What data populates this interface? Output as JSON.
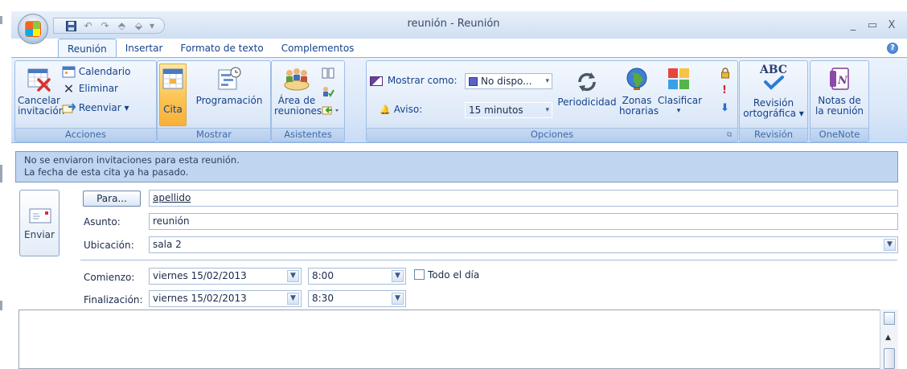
{
  "window": {
    "title": "reunión - Reunión",
    "controls": {
      "minimize": "_",
      "maximize": "▭",
      "close": "X"
    }
  },
  "quick_access": [
    "save-icon",
    "undo-icon",
    "redo-icon",
    "up-icon",
    "down-icon",
    "customize-icon"
  ],
  "tabs": [
    {
      "label": "Reunión",
      "active": true
    },
    {
      "label": "Insertar",
      "active": false
    },
    {
      "label": "Formato de texto",
      "active": false
    },
    {
      "label": "Complementos",
      "active": false
    }
  ],
  "help_label": "?",
  "ribbon": {
    "acciones": {
      "label": "Acciones",
      "cancelar_l1": "Cancelar",
      "cancelar_l2": "invitación",
      "calendario": "Calendario",
      "eliminar": "Eliminar",
      "reenviar": "Reenviar ▾"
    },
    "mostrar": {
      "label": "Mostrar",
      "cita": "Cita",
      "programacion": "Programación"
    },
    "asistentes": {
      "label": "Asistentes",
      "area_l1": "Área de",
      "area_l2": "reuniones"
    },
    "opciones": {
      "label": "Opciones",
      "mostrar_como": "Mostrar como:",
      "mostrar_como_value": "No dispo...",
      "aviso": "Aviso:",
      "aviso_value": "15 minutos",
      "periodicidad": "Periodicidad",
      "zonas_l1": "Zonas",
      "zonas_l2": "horarias",
      "clasificar": "Clasificar",
      "clasificar_arrow": "▾"
    },
    "revision": {
      "label": "Revisión",
      "abc": "ABC",
      "l1": "Revisión",
      "l2": "ortográfica ▾"
    },
    "onenote": {
      "label": "OneNote",
      "l1": "Notas de",
      "l2": "la reunión"
    }
  },
  "info": {
    "line1": "No se enviaron invitaciones para esta reunión.",
    "line2": "La fecha de esta cita ya ha pasado."
  },
  "send_label": "Enviar",
  "form": {
    "para_button": "Para...",
    "para_value": "apellido",
    "asunto_label": "Asunto:",
    "asunto_value": "reunión",
    "ubicacion_label": "Ubicación:",
    "ubicacion_value": "sala 2",
    "comienzo_label": "Comienzo:",
    "comienzo_fecha": "viernes 15/02/2013",
    "comienzo_hora": "8:00",
    "todo_el_dia": "Todo el día",
    "finalizacion_label": "Finalización:",
    "fin_fecha": "viernes 15/02/2013",
    "fin_hora": "8:30"
  }
}
